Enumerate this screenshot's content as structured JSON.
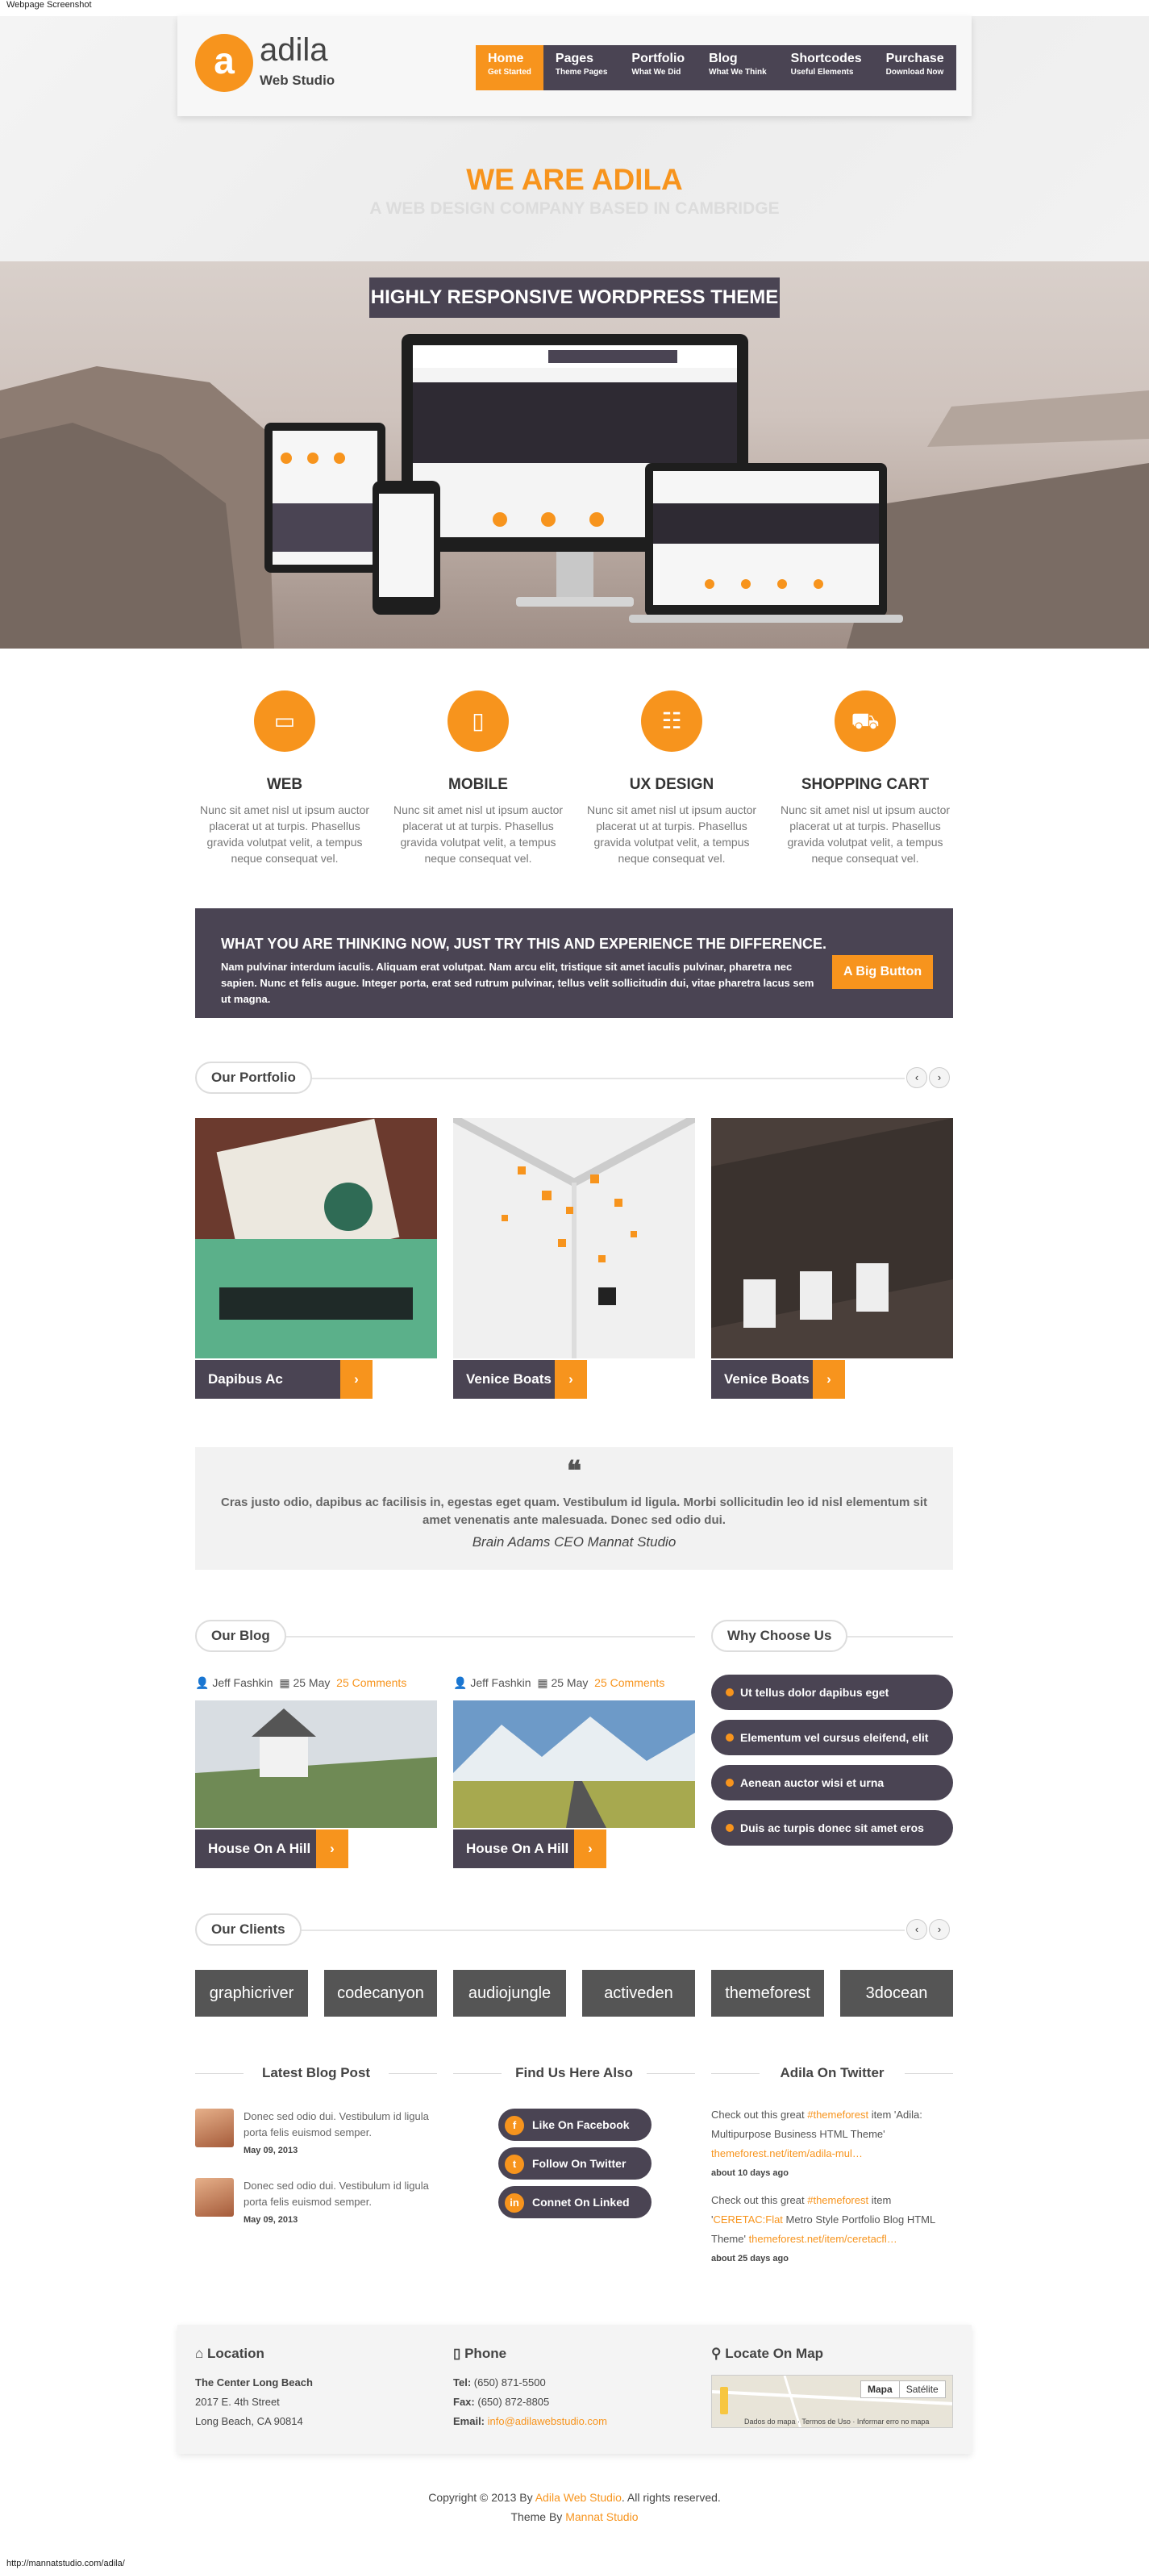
{
  "page": {
    "caption": "Webpage Screenshot",
    "url": "http://mannatstudio.com/adila/"
  },
  "logo": {
    "letter": "a",
    "name": "adila",
    "sub": "Web Studio"
  },
  "nav": [
    {
      "label": "Home",
      "sub": "Get Started"
    },
    {
      "label": "Pages",
      "sub": "Theme Pages"
    },
    {
      "label": "Portfolio",
      "sub": "What We Did"
    },
    {
      "label": "Blog",
      "sub": "What We Think"
    },
    {
      "label": "Shortcodes",
      "sub": "Useful Elements"
    },
    {
      "label": "Purchase",
      "sub": "Download Now"
    }
  ],
  "hero": {
    "title": "WE ARE ADILA",
    "subtitle": "A WEB DESIGN COMPANY BASED IN CAMBRIDGE",
    "badge": "HIGHLY RESPONSIVE WORDPRESS THEME"
  },
  "services": [
    {
      "icon": "laptop-icon",
      "title": "WEB",
      "text": "Nunc sit amet nisl ut ipsum auctor placerat ut at turpis. Phasellus gravida volutpat velit, a tempus neque consequat vel."
    },
    {
      "icon": "mobile-icon",
      "title": "MOBILE",
      "text": "Nunc sit amet nisl ut ipsum auctor placerat ut at turpis. Phasellus gravida volutpat velit, a tempus neque consequat vel."
    },
    {
      "icon": "grid-icon",
      "title": "UX DESIGN",
      "text": "Nunc sit amet nisl ut ipsum auctor placerat ut at turpis. Phasellus gravida volutpat velit, a tempus neque consequat vel."
    },
    {
      "icon": "cart-icon",
      "title": "SHOPPING CART",
      "text": "Nunc sit amet nisl ut ipsum auctor placerat ut at turpis. Phasellus gravida volutpat velit, a tempus neque consequat vel."
    }
  ],
  "cta": {
    "title": "WHAT YOU ARE THINKING NOW, JUST TRY THIS AND EXPERIENCE THE DIFFERENCE.",
    "text": "Nam pulvinar interdum iaculis. Aliquam erat volutpat. Nam arcu elit, tristique sit amet iaculis pulvinar, pharetra nec sapien. Nunc et felis augue. Integer porta, erat sed rutrum pulvinar, tellus velit sollicitudin dui, vitae pharetra lacus sem ut magna.",
    "button": "A Big Button"
  },
  "portfolio": {
    "heading": "Our Portfolio",
    "prev": "‹",
    "next": "›",
    "items": [
      {
        "title": "Dapibus Ac Facilisis"
      },
      {
        "title": "Venice Boats"
      },
      {
        "title": "Venice Boats"
      }
    ]
  },
  "quote": {
    "mark": "❝",
    "text": "Cras justo odio, dapibus ac facilisis in, egestas eget quam. Vestibulum id ligula. Morbi sollicitudin leo id nisl elementum sit amet venenatis ante malesuada. Donec sed odio dui.",
    "author": "Brain Adams CEO Mannat Studio"
  },
  "blog": {
    "heading": "Our Blog",
    "posts": [
      {
        "author": "Jeff Fashkin",
        "date": "25 May",
        "comments": "25 Comments",
        "title": "House On A Hill"
      },
      {
        "author": "Jeff Fashkin",
        "date": "25 May",
        "comments": "25 Comments",
        "title": "House On A Hill"
      }
    ]
  },
  "why": {
    "heading": "Why Choose Us",
    "items": [
      "Ut tellus dolor dapibus eget",
      "Elementum vel cursus eleifend, elit",
      "Aenean auctor wisi et urna",
      "Duis ac turpis donec sit amet eros"
    ]
  },
  "clients": {
    "heading": "Our Clients",
    "items": [
      "graphicriver",
      "codecanyon",
      "audiojungle",
      "activeden",
      "themeforest",
      "3docean"
    ]
  },
  "latest": {
    "heading": "Latest Blog Post",
    "posts": [
      {
        "text": "Donec sed odio dui. Vestibulum id ligula porta felis euismod semper.",
        "date": "May 09, 2013"
      },
      {
        "text": "Donec sed odio dui. Vestibulum id ligula porta felis euismod semper.",
        "date": "May 09, 2013"
      }
    ]
  },
  "findus": {
    "heading": "Find Us Here Also",
    "items": [
      {
        "glyph": "f",
        "label": "Like On Facebook"
      },
      {
        "glyph": "t",
        "label": "Follow On Twitter"
      },
      {
        "glyph": "in",
        "label": "Connet On Linked"
      }
    ]
  },
  "twitter": {
    "heading": "Adila On Twitter",
    "tweets": [
      {
        "pre": "Check out this great ",
        "tag": "#themeforest",
        "mid": " item 'Adila: Multipurpose Business HTML Theme' ",
        "link": "themeforest.net/item/adila-mul…",
        "date": "about 10 days ago"
      },
      {
        "pre": "Check out this great ",
        "tag": "#themeforest",
        "mid": " item '",
        "tag2": "CERETAC:Flat",
        "mid2": " Metro Style Portfolio Blog HTML Theme' ",
        "link": "themeforest.net/item/ceretacfl…",
        "date": "about 25 days ago"
      }
    ]
  },
  "footer": {
    "location": {
      "title": "Location",
      "name": "The Center Long Beach",
      "line1": "2017 E. 4th Street",
      "line2": "Long Beach, CA 90814"
    },
    "phone": {
      "title": "Phone",
      "tel_label": "Tel:",
      "tel": "(650) 871-5500",
      "fax_label": "Fax:",
      "fax": "(650) 872-8805",
      "email_label": "Email:",
      "email": "info@adilawebstudio.com"
    },
    "map": {
      "title": "Locate On Map",
      "tab1": "Mapa",
      "tab2": "Satélite",
      "credit": "Dados do mapa · Termos de Uso · Informar erro no mapa"
    }
  },
  "copyright": {
    "pre": "Copyright © 2013 By ",
    "brand": "Adila Web Studio",
    "post": ". All rights reserved.",
    "theme_pre": "Theme By ",
    "theme": "Mannat Studio"
  },
  "colors": {
    "accent": "#f7941d",
    "dark": "#4a4453"
  }
}
